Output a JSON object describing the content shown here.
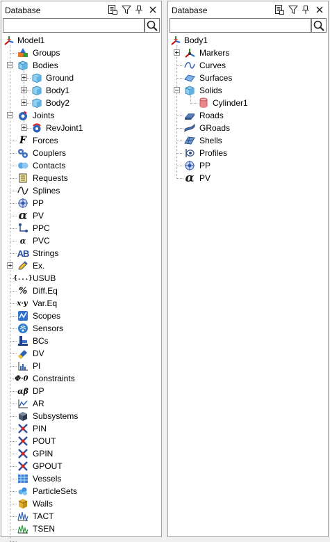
{
  "left_panel": {
    "title": "Database",
    "search_value": "",
    "root": "Model1",
    "items": [
      {
        "label": "Groups"
      },
      {
        "label": "Bodies",
        "children": [
          "Ground",
          "Body1",
          "Body2"
        ]
      },
      {
        "label": "Joints",
        "children": [
          "RevJoint1"
        ]
      },
      {
        "label": "Forces"
      },
      {
        "label": "Couplers"
      },
      {
        "label": "Contacts"
      },
      {
        "label": "Requests"
      },
      {
        "label": "Splines"
      },
      {
        "label": "PP"
      },
      {
        "label": "PV"
      },
      {
        "label": "PPC"
      },
      {
        "label": "PVC"
      },
      {
        "label": "Strings"
      },
      {
        "label": "Ex."
      },
      {
        "label": "USUB"
      },
      {
        "label": "Diff.Eq"
      },
      {
        "label": "Var.Eq"
      },
      {
        "label": "Scopes"
      },
      {
        "label": "Sensors"
      },
      {
        "label": "BCs"
      },
      {
        "label": "DV"
      },
      {
        "label": "PI"
      },
      {
        "label": "Constraints"
      },
      {
        "label": "DP"
      },
      {
        "label": "AR"
      },
      {
        "label": "Subsystems"
      },
      {
        "label": "PIN"
      },
      {
        "label": "POUT"
      },
      {
        "label": "GPIN"
      },
      {
        "label": "GPOUT"
      },
      {
        "label": "Vessels"
      },
      {
        "label": "ParticleSets"
      },
      {
        "label": "Walls"
      },
      {
        "label": "TACT"
      },
      {
        "label": "TSEN"
      }
    ]
  },
  "right_panel": {
    "title": "Database",
    "search_value": "",
    "root": "Body1",
    "items": [
      {
        "label": "Markers"
      },
      {
        "label": "Curves"
      },
      {
        "label": "Surfaces"
      },
      {
        "label": "Solids",
        "children": [
          "Cylinder1"
        ]
      },
      {
        "label": "Roads"
      },
      {
        "label": "GRoads"
      },
      {
        "label": "Shells"
      },
      {
        "label": "Profiles"
      },
      {
        "label": "PP"
      },
      {
        "label": "PV"
      }
    ]
  },
  "icon_glyphs": {
    "forces": "F",
    "pv": "α",
    "pvc": "α",
    "strings": "AB",
    "usub": "{...}",
    "diffeq": "%",
    "vareq": "x·y",
    "constraints": "Φ·0",
    "dp": "αβ"
  }
}
